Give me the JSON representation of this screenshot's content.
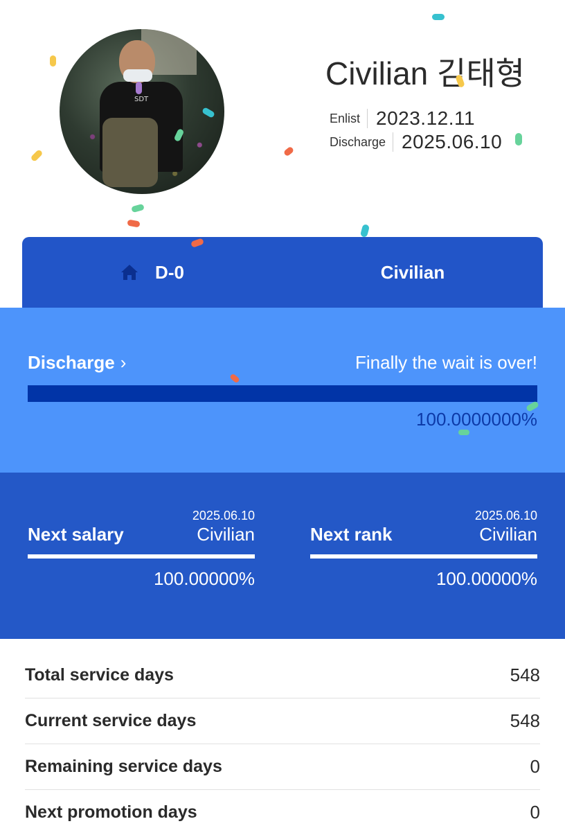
{
  "profile": {
    "name": "Civilian 김태형",
    "shirt_text": "SDT",
    "enlist_label": "Enlist",
    "enlist_date": "2023.12.11",
    "discharge_label": "Discharge",
    "discharge_date": "2025.06.10"
  },
  "tabs": {
    "dday": "D-0",
    "status": "Civilian",
    "home_icon": "home-icon"
  },
  "discharge": {
    "title": "Discharge",
    "chevron": "›",
    "message": "Finally the wait is over!",
    "progress": 1.0,
    "percent_text": "100.0000000%"
  },
  "next_salary": {
    "title": "Next salary",
    "date": "2025.06.10",
    "value": "Civilian",
    "progress": 1.0,
    "percent_text": "100.00000%"
  },
  "next_rank": {
    "title": "Next rank",
    "date": "2025.06.10",
    "value": "Civilian",
    "progress": 1.0,
    "percent_text": "100.00000%"
  },
  "stats": [
    {
      "label": "Total service days",
      "value": "548"
    },
    {
      "label": "Current service days",
      "value": "548"
    },
    {
      "label": "Remaining service days",
      "value": "0"
    },
    {
      "label": "Next promotion days",
      "value": "0"
    }
  ],
  "colors": {
    "accent_dark": "#2255c8",
    "accent_light": "#4d94fb",
    "progress_fill": "#0134a7"
  }
}
